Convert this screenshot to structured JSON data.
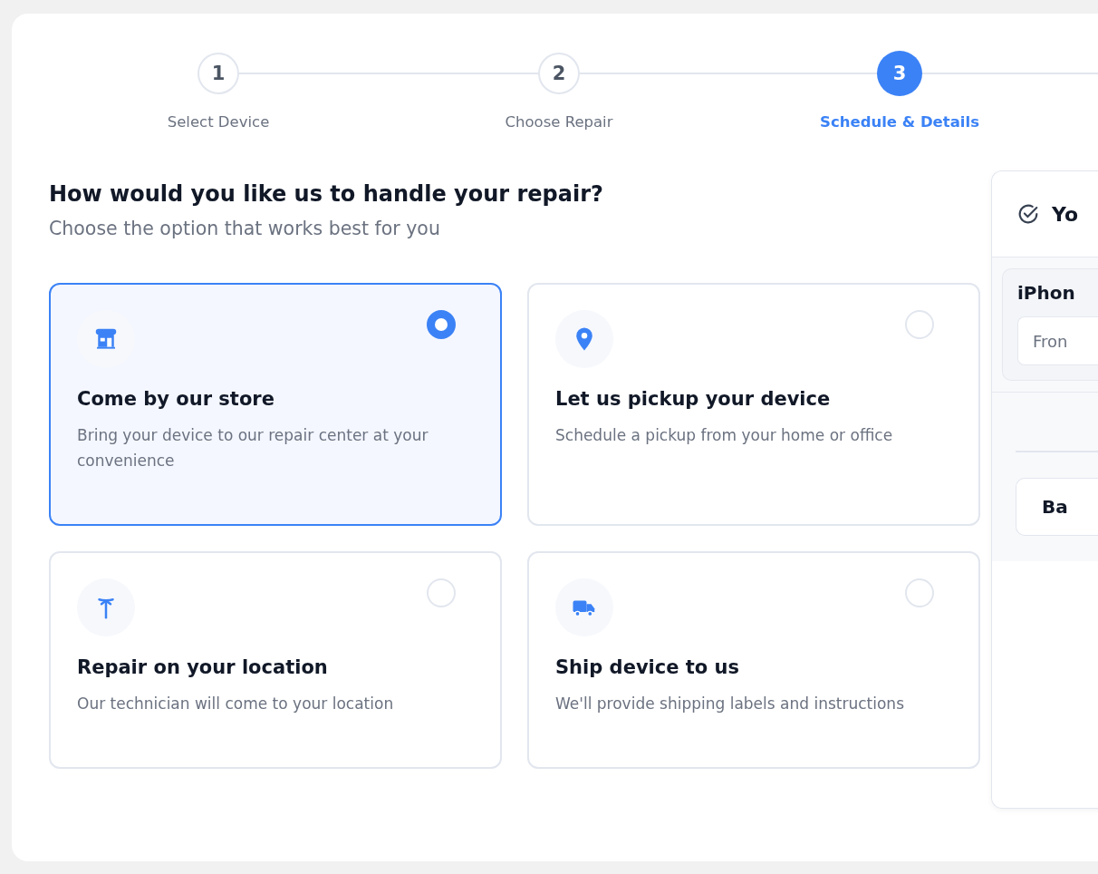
{
  "stepper": {
    "steps": [
      {
        "number": "1",
        "label": "Select Device",
        "selected": false
      },
      {
        "number": "2",
        "label": "Choose Repair",
        "selected": false
      },
      {
        "number": "3",
        "label": "Schedule & Details",
        "selected": true
      }
    ]
  },
  "heading": "How would you like us to handle your repair?",
  "subheading": "Choose the option that works best for you",
  "options": [
    {
      "kind": "store",
      "title": "Come by our store",
      "description": "Bring your device to our repair center at your convenience",
      "selected": true
    },
    {
      "kind": "pin",
      "title": "Let us pickup your device",
      "description": "Schedule a pickup from your home or office",
      "selected": false
    },
    {
      "kind": "antenna",
      "title": "Repair on your location",
      "description": "Our technician will come to your location",
      "selected": false
    },
    {
      "kind": "truck",
      "title": "Ship device to us",
      "description": "We'll provide shipping labels and instructions",
      "selected": false
    }
  ],
  "summary": {
    "title": "Yo",
    "item_name": "iPhon",
    "placeholder": "Fron",
    "button": "Ba"
  }
}
